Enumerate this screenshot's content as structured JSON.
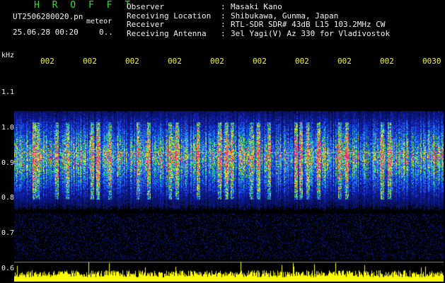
{
  "header": {
    "title": "H R O F F T",
    "file_name": "UT2506280020.pn",
    "meteor_label": "meteor",
    "date_time": "25.06.28 00:20",
    "indicator": "0.."
  },
  "info": [
    {
      "key": "Observer",
      "value": "Masaki Kano"
    },
    {
      "key": "Receiving Location",
      "value": "Shibukawa, Gunma, Japan"
    },
    {
      "key": "Receiver",
      "value": "RTL-SDR SDR# 43dB L15 103.2MHz CW"
    },
    {
      "key": "Receiving Antenna",
      "value": "3el Yagi(V) Az 330 for Vladivostok"
    }
  ],
  "axis": {
    "unit": "kHz",
    "y_ticks": [
      "1.1",
      "1.0",
      "0.9",
      "0.8",
      "0.7",
      "0.6"
    ],
    "x_ticks": [
      "002",
      "002",
      "002",
      "002",
      "002",
      "002",
      "002",
      "002",
      "002",
      "0030"
    ]
  },
  "colors": {
    "background": "#000000",
    "header_green": "#28e628",
    "text_white": "#f2f2f2",
    "label_yellow": "#f2f23a",
    "noise_blue": "#1a3cff",
    "signal_magenta": "#ff2a7a",
    "power_yellow": "#ffff00"
  }
}
